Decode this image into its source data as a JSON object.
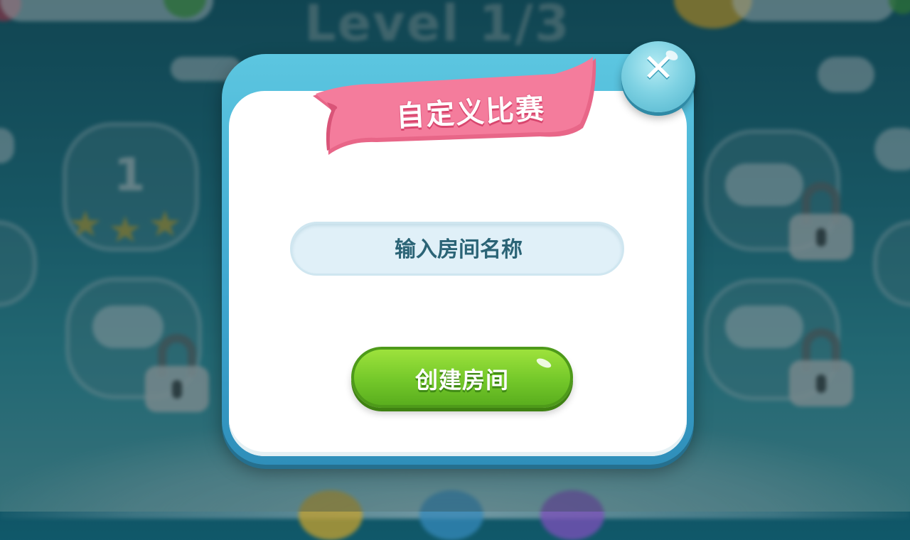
{
  "background": {
    "level_title": "Level 1/3",
    "level_node_number": "1"
  },
  "dialog": {
    "title": "自定义比赛",
    "close_label": "✕",
    "room_name_placeholder": "输入房间名称",
    "room_name_value": "",
    "create_button_label": "创建房间"
  },
  "colors": {
    "dialog_frame": "#3ea6cf",
    "banner_pink": "#f47c9c",
    "create_button_green": "#74c82a",
    "input_text": "#2b6476"
  },
  "icons": {
    "close": "close-icon",
    "lock": "lock-icon",
    "star": "star-icon"
  }
}
